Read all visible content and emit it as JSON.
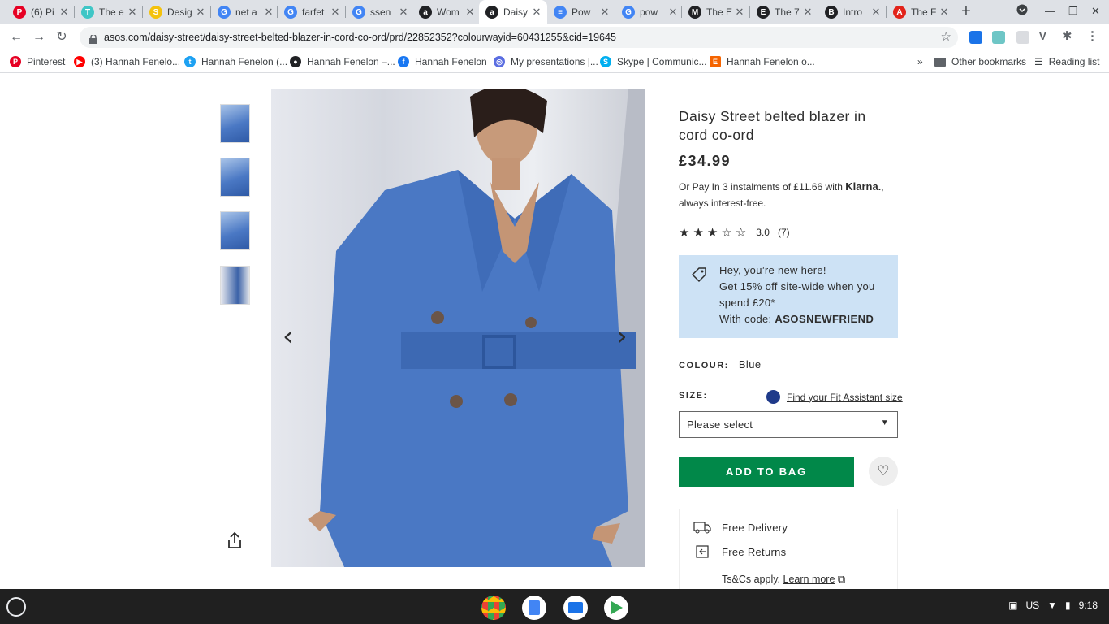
{
  "tabs": [
    {
      "label": "(6) Pi",
      "icon": "pinterest-icon",
      "color": "#e60023",
      "glyph": "P"
    },
    {
      "label": "The e",
      "icon": "design-icon",
      "color": "#3fc6c6",
      "glyph": "T"
    },
    {
      "label": "Desig",
      "icon": "dollar-icon",
      "color": "#f4c20d",
      "glyph": "S"
    },
    {
      "label": "net a",
      "icon": "google-icon",
      "color": "#4285f4",
      "glyph": "G"
    },
    {
      "label": "farfet",
      "icon": "google-icon",
      "color": "#4285f4",
      "glyph": "G"
    },
    {
      "label": "ssen",
      "icon": "google-icon",
      "color": "#4285f4",
      "glyph": "G"
    },
    {
      "label": "Wom",
      "icon": "asos-icon",
      "color": "#202124",
      "glyph": "a"
    },
    {
      "label": "Daisy",
      "icon": "asos-icon",
      "color": "#202124",
      "glyph": "a"
    },
    {
      "label": "Pow",
      "icon": "docs-icon",
      "color": "#4285f4",
      "glyph": "≡"
    },
    {
      "label": "pow",
      "icon": "google-icon",
      "color": "#4285f4",
      "glyph": "G"
    },
    {
      "label": "The E",
      "icon": "medium-icon",
      "color": "#202124",
      "glyph": "M"
    },
    {
      "label": "The 7",
      "icon": "etsy-icon",
      "color": "#202124",
      "glyph": "E"
    },
    {
      "label": "Intro",
      "icon": "b-icon",
      "color": "#202124",
      "glyph": "B"
    },
    {
      "label": "The F",
      "icon": "acrobat-icon",
      "color": "#e2231a",
      "glyph": "A"
    }
  ],
  "address": {
    "url": "asos.com/daisy-street/daisy-street-belted-blazer-in-cord-co-ord/prd/22852352?colourwayid=60431255&cid=19645"
  },
  "bookmarks": [
    {
      "label": "Pinterest",
      "icon": "pinterest-icon",
      "color": "#e60023",
      "glyph": "P"
    },
    {
      "label": "(3) Hannah Fenelo...",
      "icon": "youtube-icon",
      "color": "#ff0000",
      "glyph": "▶"
    },
    {
      "label": "Hannah Fenelon (...",
      "icon": "twitter-icon",
      "color": "#1da1f2",
      "glyph": "t"
    },
    {
      "label": "Hannah Fenelon –...",
      "icon": "medium-icon",
      "color": "#202124",
      "glyph": "●"
    },
    {
      "label": "Hannah Fenelon",
      "icon": "facebook-icon",
      "color": "#1877f2",
      "glyph": "f"
    },
    {
      "label": "My presentations |...",
      "icon": "presentations-icon",
      "color": "#5b6ee1",
      "glyph": "◎"
    },
    {
      "label": "Skype | Communic...",
      "icon": "skype-icon",
      "color": "#00aff0",
      "glyph": "S"
    },
    {
      "label": "Hannah Fenelon o...",
      "icon": "etsy-icon",
      "color": "#f56400",
      "glyph": "E"
    }
  ],
  "bookmarks_more": "»",
  "other_bookmarks": "Other bookmarks",
  "reading_list": "Reading list",
  "product": {
    "title": "Daisy Street belted blazer in cord co-ord",
    "price": "£34.99",
    "klarna_pre": "Or Pay In 3 instalments of £11.66 with ",
    "klarna_brand": "Klarna.",
    "klarna_post": ", always interest-free.",
    "rating_value": "3.0",
    "rating_count": "(7)",
    "stars_filled": 3,
    "stars_total": 5,
    "promo_line1": "Hey, you’re new here!",
    "promo_line2": "Get 15% off site-wide when you spend £20*",
    "promo_line3": "With code: ",
    "promo_code": "ASOSNEWFRIEND",
    "colour_label": "COLOUR:",
    "colour_value": "Blue",
    "size_label": "SIZE:",
    "fit_link": "Find your Fit Assistant size",
    "size_placeholder": "Please select",
    "add_to_bag": "ADD TO BAG",
    "free_delivery": "Free Delivery",
    "free_returns": "Free Returns",
    "ts_text": "Ts&Cs apply. ",
    "learn_more": "Learn more"
  },
  "taskbar": {
    "locale": "US",
    "time": "9:18"
  },
  "colors": {
    "addbag": "#018849",
    "promo_bg": "#cde2f5",
    "product_blue": "#4a78c4"
  }
}
